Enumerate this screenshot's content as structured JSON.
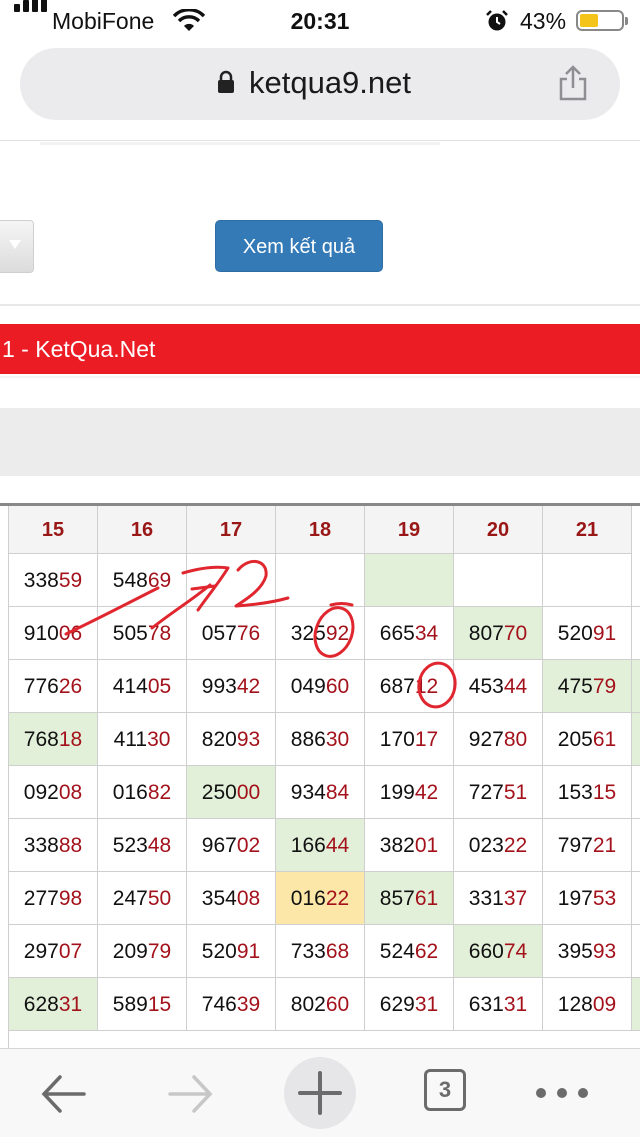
{
  "status": {
    "carrier": "MobiFone",
    "time": "20:31",
    "battery": "43%"
  },
  "browser": {
    "url": "ketqua9.net",
    "tab_count": "3"
  },
  "form": {
    "submit_label": "Xem kết quả"
  },
  "banner": {
    "title": "1 - KetQua.Net"
  },
  "table": {
    "columns": [
      "15",
      "16",
      "17",
      "18",
      "19",
      "20",
      "21"
    ],
    "rows": [
      [
        {
          "v": "33859"
        },
        {
          "v": "54869"
        },
        {
          "v": ""
        },
        {
          "v": ""
        },
        {
          "v": "",
          "bg": "green"
        },
        {
          "v": ""
        },
        {
          "v": ""
        }
      ],
      [
        {
          "v": "91006"
        },
        {
          "v": "50578"
        },
        {
          "v": "05776"
        },
        {
          "v": "32592"
        },
        {
          "v": "66534"
        },
        {
          "v": "80770",
          "bg": "green"
        },
        {
          "v": "52091"
        }
      ],
      [
        {
          "v": "77626"
        },
        {
          "v": "41405"
        },
        {
          "v": "99342"
        },
        {
          "v": "04960"
        },
        {
          "v": "68712"
        },
        {
          "v": "45344"
        },
        {
          "v": "47579",
          "bg": "green"
        }
      ],
      [
        {
          "v": "76818",
          "bg": "green"
        },
        {
          "v": "41130"
        },
        {
          "v": "82093"
        },
        {
          "v": "88630"
        },
        {
          "v": "17017"
        },
        {
          "v": "92780"
        },
        {
          "v": "20561"
        }
      ],
      [
        {
          "v": "09208"
        },
        {
          "v": "01682"
        },
        {
          "v": "25000",
          "bg": "green"
        },
        {
          "v": "93484"
        },
        {
          "v": "19942"
        },
        {
          "v": "72751"
        },
        {
          "v": "15315"
        }
      ],
      [
        {
          "v": "33888"
        },
        {
          "v": "52348"
        },
        {
          "v": "96702"
        },
        {
          "v": "16644",
          "bg": "green"
        },
        {
          "v": "38201"
        },
        {
          "v": "02322"
        },
        {
          "v": "79721"
        }
      ],
      [
        {
          "v": "27798"
        },
        {
          "v": "24750"
        },
        {
          "v": "35408"
        },
        {
          "v": "01622",
          "bg": "yellow"
        },
        {
          "v": "85761",
          "bg": "green"
        },
        {
          "v": "33137"
        },
        {
          "v": "19753"
        }
      ],
      [
        {
          "v": "29707"
        },
        {
          "v": "20979"
        },
        {
          "v": "52091"
        },
        {
          "v": "73368"
        },
        {
          "v": "52462"
        },
        {
          "v": "66074",
          "bg": "green"
        },
        {
          "v": "39593"
        }
      ],
      [
        {
          "v": "62831",
          "bg": "green"
        },
        {
          "v": "58915"
        },
        {
          "v": "74639"
        },
        {
          "v": "80260"
        },
        {
          "v": "62931"
        },
        {
          "v": "63131"
        },
        {
          "v": "12809"
        }
      ]
    ]
  },
  "annotation": {
    "text": "72"
  },
  "colors": {
    "button": "#337ab7",
    "banner": "#ec1c24",
    "number_suffix": "#a3121b",
    "header_text": "#9a1717",
    "highlight_green": "#e2f0d9",
    "highlight_yellow": "#fce7a8",
    "ink": "#e0262e"
  },
  "icons": [
    "signal-icon",
    "wifi-icon",
    "alarm-icon",
    "battery-icon",
    "lock-icon",
    "share-icon",
    "back-icon",
    "forward-icon",
    "new-tab-icon",
    "tabs-icon",
    "more-icon"
  ]
}
